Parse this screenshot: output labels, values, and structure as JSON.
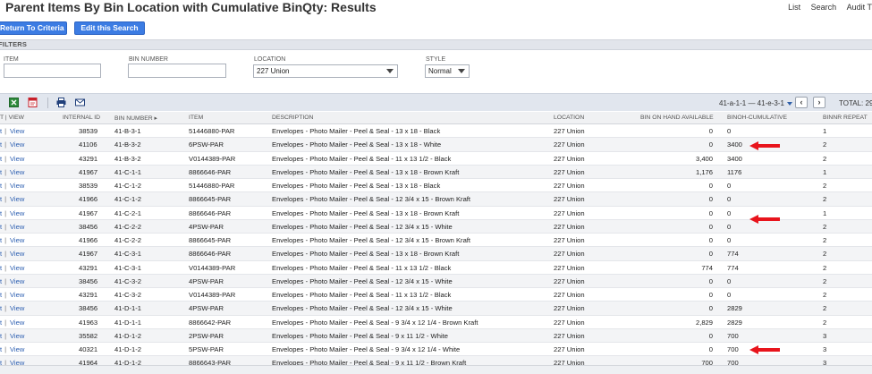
{
  "header": {
    "title": "Parent Items By Bin Location with Cumulative BinQty: Results",
    "links": [
      "List",
      "Search",
      "Audit T"
    ]
  },
  "actions": {
    "return_label": "Return To Criteria",
    "edit_label": "Edit this Search"
  },
  "filters": {
    "section_title": "FILTERS",
    "item_label": "ITEM",
    "item_value": "",
    "bin_number_label": "BIN NUMBER",
    "bin_number_value": "",
    "location_label": "LOCATION",
    "location_value": "227 Union",
    "style_label": "STYLE",
    "style_value": "Normal"
  },
  "toolbar": {
    "icons": [
      "excel-export-icon",
      "pdf-export-icon",
      "print-icon",
      "email-icon"
    ],
    "range": "41-a-1-1 — 41-e-3-1",
    "prev": "‹",
    "next": "›",
    "total": "TOTAL: 29"
  },
  "table": {
    "columns": [
      "T | VIEW",
      "INTERNAL ID",
      "BIN NUMBER ▸",
      "ITEM",
      "DESCRIPTION",
      "LOCATION",
      "BIN ON HAND AVAILABLE",
      "BINOH-CUMULATIVE",
      "BINNR REPEAT"
    ],
    "edit_text": "t",
    "sep_text": " | ",
    "view_text": "View",
    "rows": [
      {
        "id": "38539",
        "bin": "41-B-3-1",
        "item": "51446880-PAR",
        "desc": "Envelopes - Photo Mailer - Peel & Seal - 13 x 18 - Black",
        "loc": "227 Union",
        "avail": "0",
        "cum": "0",
        "repeat": "1"
      },
      {
        "id": "41106",
        "bin": "41-B-3-2",
        "item": "6PSW-PAR",
        "desc": "Envelopes - Photo Mailer - Peel & Seal - 13 x 18 - White",
        "loc": "227 Union",
        "avail": "0",
        "cum": "3400",
        "repeat": "2"
      },
      {
        "id": "43291",
        "bin": "41-B-3-2",
        "item": "V0144389-PAR",
        "desc": "Envelopes - Photo Mailer - Peel & Seal - 11 x 13 1/2 - Black",
        "loc": "227 Union",
        "avail": "3,400",
        "cum": "3400",
        "repeat": "2"
      },
      {
        "id": "41967",
        "bin": "41-C-1-1",
        "item": "8866646-PAR",
        "desc": "Envelopes - Photo Mailer - Peel & Seal - 13 x 18 - Brown Kraft",
        "loc": "227 Union",
        "avail": "1,176",
        "cum": "1176",
        "repeat": "1"
      },
      {
        "id": "38539",
        "bin": "41-C-1-2",
        "item": "51446880-PAR",
        "desc": "Envelopes - Photo Mailer - Peel & Seal - 13 x 18 - Black",
        "loc": "227 Union",
        "avail": "0",
        "cum": "0",
        "repeat": "2"
      },
      {
        "id": "41966",
        "bin": "41-C-1-2",
        "item": "8866645-PAR",
        "desc": "Envelopes - Photo Mailer - Peel & Seal - 12 3/4 x 15 - Brown Kraft",
        "loc": "227 Union",
        "avail": "0",
        "cum": "0",
        "repeat": "2"
      },
      {
        "id": "41967",
        "bin": "41-C-2-1",
        "item": "8866646-PAR",
        "desc": "Envelopes - Photo Mailer - Peel & Seal - 13 x 18 - Brown Kraft",
        "loc": "227 Union",
        "avail": "0",
        "cum": "0",
        "repeat": "1"
      },
      {
        "id": "38456",
        "bin": "41-C-2-2",
        "item": "4PSW-PAR",
        "desc": "Envelopes - Photo Mailer - Peel & Seal - 12 3/4 x 15 - White",
        "loc": "227 Union",
        "avail": "0",
        "cum": "0",
        "repeat": "2"
      },
      {
        "id": "41966",
        "bin": "41-C-2-2",
        "item": "8866645-PAR",
        "desc": "Envelopes - Photo Mailer - Peel & Seal - 12 3/4 x 15 - Brown Kraft",
        "loc": "227 Union",
        "avail": "0",
        "cum": "0",
        "repeat": "2"
      },
      {
        "id": "41967",
        "bin": "41-C-3-1",
        "item": "8866646-PAR",
        "desc": "Envelopes - Photo Mailer - Peel & Seal - 13 x 18 - Brown Kraft",
        "loc": "227 Union",
        "avail": "0",
        "cum": "774",
        "repeat": "2"
      },
      {
        "id": "43291",
        "bin": "41-C-3-1",
        "item": "V0144389-PAR",
        "desc": "Envelopes - Photo Mailer - Peel & Seal - 11 x 13 1/2 - Black",
        "loc": "227 Union",
        "avail": "774",
        "cum": "774",
        "repeat": "2"
      },
      {
        "id": "38456",
        "bin": "41-C-3-2",
        "item": "4PSW-PAR",
        "desc": "Envelopes - Photo Mailer - Peel & Seal - 12 3/4 x 15 - White",
        "loc": "227 Union",
        "avail": "0",
        "cum": "0",
        "repeat": "2"
      },
      {
        "id": "43291",
        "bin": "41-C-3-2",
        "item": "V0144389-PAR",
        "desc": "Envelopes - Photo Mailer - Peel & Seal - 11 x 13 1/2 - Black",
        "loc": "227 Union",
        "avail": "0",
        "cum": "0",
        "repeat": "2"
      },
      {
        "id": "38456",
        "bin": "41-D-1-1",
        "item": "4PSW-PAR",
        "desc": "Envelopes - Photo Mailer - Peel & Seal - 12 3/4 x 15 - White",
        "loc": "227 Union",
        "avail": "0",
        "cum": "2829",
        "repeat": "2"
      },
      {
        "id": "41963",
        "bin": "41-D-1-1",
        "item": "8866642-PAR",
        "desc": "Envelopes - Photo Mailer - Peel & Seal - 9 3/4 x 12 1/4 - Brown Kraft",
        "loc": "227 Union",
        "avail": "2,829",
        "cum": "2829",
        "repeat": "2"
      },
      {
        "id": "35582",
        "bin": "41-D-1-2",
        "item": "2PSW-PAR",
        "desc": "Envelopes - Photo Mailer - Peel & Seal - 9 x 11 1/2 - White",
        "loc": "227 Union",
        "avail": "0",
        "cum": "700",
        "repeat": "3"
      },
      {
        "id": "40321",
        "bin": "41-D-1-2",
        "item": "5PSW-PAR",
        "desc": "Envelopes - Photo Mailer - Peel & Seal - 9 3/4 x 12 1/4 - White",
        "loc": "227 Union",
        "avail": "0",
        "cum": "700",
        "repeat": "3"
      },
      {
        "id": "41964",
        "bin": "41-D-1-2",
        "item": "8866643-PAR",
        "desc": "Envelopes - Photo Mailer - Peel & Seal - 9 x 11 1/2 - Brown Kraft",
        "loc": "227 Union",
        "avail": "700",
        "cum": "700",
        "repeat": "3"
      }
    ]
  },
  "annotations": {
    "arrow_color": "#e8141c",
    "arrow_rows": [
      1,
      6,
      15
    ]
  }
}
